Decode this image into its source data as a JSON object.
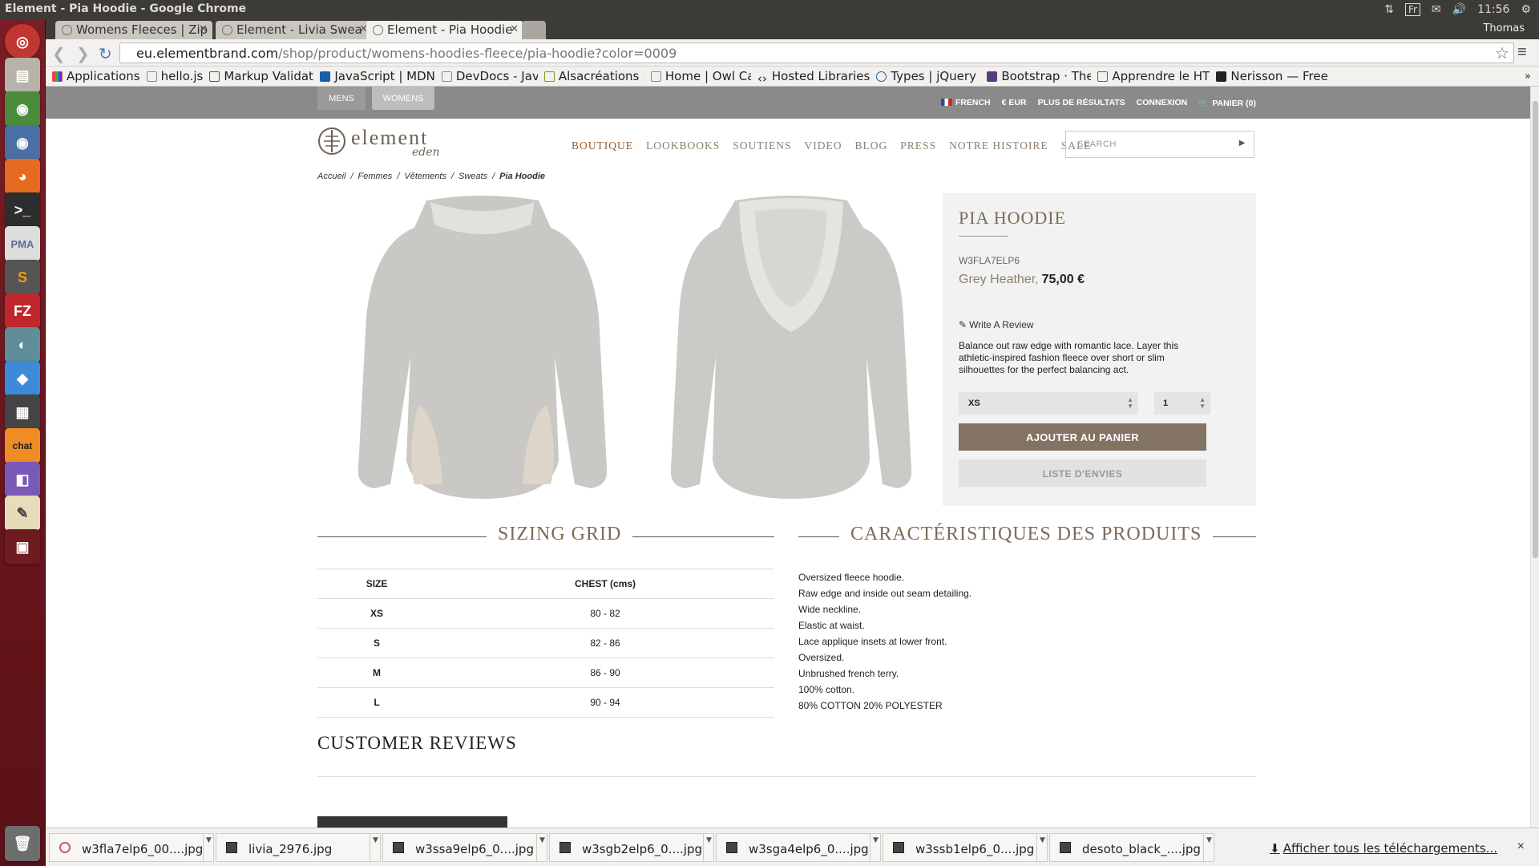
{
  "os": {
    "window_title": "Element - Pia Hoodie - Google Chrome",
    "keyboard_layout": "Fr",
    "clock": "11:56",
    "user": "Thomas"
  },
  "browser": {
    "tabs": [
      {
        "label": "Womens Fleeces | Zip",
        "active": false
      },
      {
        "label": "Element - Livia Swea",
        "active": false
      },
      {
        "label": "Element - Pia Hoodie",
        "active": true
      }
    ],
    "url_host": "eu.elementbrand.com",
    "url_path": "/shop/product/womens-hoodies-fleece/pia-hoodie?color=0009",
    "bookmarks": [
      "Applications",
      "hello.js",
      "Markup Validatio",
      "JavaScript | MDN",
      "DevDocs - JavaSc",
      "Alsacréations : Ac",
      "Home | Owl Carou",
      "Hosted Libraries",
      "Types | jQuery AP",
      "Bootstrap · The w",
      "Apprendre le HTM",
      "Nerisson — Freel"
    ]
  },
  "site": {
    "gender_tabs": [
      "MENS",
      "WOMENS"
    ],
    "util_links": {
      "language": "FRENCH",
      "currency": "€ EUR",
      "more_results": "PLUS DE RÉSULTATS",
      "login": "CONNEXION",
      "cart": "PANIER (0)"
    },
    "logo": {
      "brand": "element",
      "sub": "eden"
    },
    "nav": [
      "BOUTIQUE",
      "LOOKBOOKS",
      "SOUTIENS",
      "VIDEO",
      "BLOG",
      "PRESS",
      "NOTRE HISTOIRE",
      "SALE"
    ],
    "search_placeholder": "SEARCH",
    "breadcrumb": [
      "Accueil",
      "Femmes",
      "Vêtements",
      "Sweats",
      "Pia Hoodie"
    ]
  },
  "product": {
    "title": "PIA HOODIE",
    "sku": "W3FLA7ELP6",
    "color": "Grey Heather,",
    "price": "75,00 €",
    "review_link": "Write A Review",
    "description": "Balance out raw edge with romantic lace. Layer this athletic-inspired fashion fleece over short or slim silhouettes for the perfect balancing act.",
    "size_selected": "XS",
    "quantity": "1",
    "add_to_cart": "AJOUTER AU PANIER",
    "wishlist": "LISTE D'ENVIES",
    "images": [
      "front view",
      "back view"
    ]
  },
  "sizing": {
    "heading": "SIZING GRID",
    "columns": [
      "SIZE",
      "CHEST (cms)"
    ],
    "rows": [
      [
        "XS",
        "80 - 82"
      ],
      [
        "S",
        "82 - 86"
      ],
      [
        "M",
        "86 - 90"
      ],
      [
        "L",
        "90 - 94"
      ]
    ]
  },
  "features": {
    "heading": "CARACTÉRISTIQUES DES PRODUITS",
    "items": [
      "Oversized fleece hoodie.",
      "Raw edge and inside out seam detailing.",
      "Wide neckline.",
      "Elastic at waist.",
      "Lace applique insets at lower front.",
      "Oversized.",
      "Unbrushed french terry.",
      "100% cotton.",
      "80% COTTON 20% POLYESTER"
    ]
  },
  "reviews": {
    "heading": "CUSTOMER REVIEWS"
  },
  "downloads": {
    "files": [
      "w3fla7elp6_00....jpg",
      "livia_2976.jpg",
      "w3ssa9elp6_0....jpg",
      "w3sgb2elp6_0....jpg",
      "w3sga4elp6_0....jpg",
      "w3ssb1elp6_0....jpg",
      "desoto_black_....jpg"
    ],
    "show_all": "Afficher tous les téléchargements...",
    "close": "×"
  }
}
